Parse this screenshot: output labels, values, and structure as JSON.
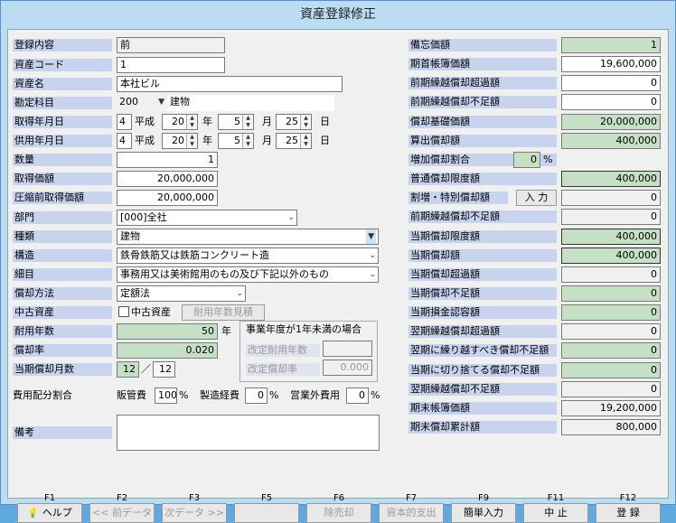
{
  "window": {
    "title": "資産登録修正"
  },
  "left": {
    "touroku": {
      "label": "登録内容",
      "value": "前"
    },
    "code": {
      "label": "資産コード",
      "value": "1"
    },
    "name": {
      "label": "資産名",
      "value": "本社ビル"
    },
    "kamoku": {
      "label": "勘定科目",
      "code": "200",
      "name": "建物"
    },
    "shutoku": {
      "label": "取得年月日",
      "era_code": "4",
      "era": "平成",
      "year": "20",
      "month": "5",
      "day": "25",
      "y": "年",
      "m": "月",
      "d": "日"
    },
    "kyouyo": {
      "label": "供用年月日",
      "era_code": "4",
      "era": "平成",
      "year": "20",
      "month": "5",
      "day": "25",
      "y": "年",
      "m": "月",
      "d": "日"
    },
    "suuryou": {
      "label": "数量",
      "value": "1"
    },
    "kakaku": {
      "label": "取得価額",
      "value": "20,000,000"
    },
    "asshuku": {
      "label": "圧縮前取得価額",
      "value": "20,000,000"
    },
    "bumon": {
      "label": "部門",
      "value": "[000]全社"
    },
    "shurui": {
      "label": "種類",
      "value": "建物"
    },
    "kouzou": {
      "label": "構造",
      "value": "鉄骨鉄筋又は鉄筋コンクリート造"
    },
    "saimoku": {
      "label": "細目",
      "value": "事務用又は美術館用のもの及び下記以外のもの"
    },
    "houhou": {
      "label": "償却方法",
      "value": "定額法"
    },
    "chuko": {
      "label": "中古資産",
      "check_label": "中古資産",
      "btn": "耐用年数見積"
    },
    "taiyou": {
      "label": "耐用年数",
      "value": "50",
      "unit": "年"
    },
    "ritsu": {
      "label": "償却率",
      "value": "0.020"
    },
    "tsukisuu": {
      "label": "当期償却月数",
      "value": "12",
      "sep": "／",
      "total": "12"
    },
    "group": {
      "title": "事業年度が1年未満の場合",
      "kaitei_nensuu": "改定耐用年数",
      "kaitei_ritsu": "改定償却率",
      "kaitei_ritsu_val": "0.000"
    },
    "haifu": {
      "label": "費用配分割合",
      "hankan": "販管費",
      "hankan_val": "100",
      "seizou": "製造経費",
      "seizou_val": "0",
      "eigaigai": "営業外費用",
      "eigaigai_val": "0",
      "pct": "%"
    },
    "bikou": {
      "label": "備考"
    }
  },
  "right": {
    "rows": [
      {
        "label": "備忘価額",
        "value": "1"
      },
      {
        "label": "期首帳簿価額",
        "value": "19,600,000"
      },
      {
        "label": "前期繰越償却超過額",
        "value": "0"
      },
      {
        "label": "前期繰越償却不足額",
        "value": "0"
      },
      {
        "label": "償却基礎価額",
        "value": "20,000,000"
      },
      {
        "label": "算出償却額",
        "value": "400,000"
      },
      {
        "label": "増加償却割合",
        "value": "0",
        "unit": "%"
      },
      {
        "label": "普通償却限度額",
        "value": "400,000"
      },
      {
        "label": "割増・特別償却額",
        "value": "0",
        "btn": "入 力"
      },
      {
        "label": "前期繰越償却不足額",
        "value": "0"
      },
      {
        "label": "当期償却限度額",
        "value": "400,000"
      },
      {
        "label": "当期償却額",
        "value": "400,000"
      },
      {
        "label": "当期償却超過額",
        "value": "0"
      },
      {
        "label": "当期償却不足額",
        "value": "0"
      },
      {
        "label": "当期損金認容額",
        "value": "0"
      },
      {
        "label": "翌期繰越償却超過額",
        "value": "0"
      },
      {
        "label": "翌期に繰り越すべき償却不足額",
        "value": "0"
      },
      {
        "label": "当期に切り捨てる償却不足額",
        "value": "0"
      },
      {
        "label": "翌期繰越償却不足額",
        "value": "0"
      },
      {
        "label": "期末帳簿価額",
        "value": "19,200,000"
      },
      {
        "label": "期末償却累計額",
        "value": "800,000"
      }
    ]
  },
  "fkeys": [
    {
      "key": "F1",
      "label": "ヘルプ",
      "icon": "help-icon"
    },
    {
      "key": "F2",
      "label": "<< 前データ"
    },
    {
      "key": "F3",
      "label": "次データ >>"
    },
    {
      "key": "F5",
      "label": ""
    },
    {
      "key": "F6",
      "label": "除売却"
    },
    {
      "key": "F7",
      "label": "資本的支出"
    },
    {
      "key": "F9",
      "label": "簡単入力"
    },
    {
      "key": "F11",
      "label": "中 止"
    },
    {
      "key": "F12",
      "label": "登 録"
    }
  ]
}
